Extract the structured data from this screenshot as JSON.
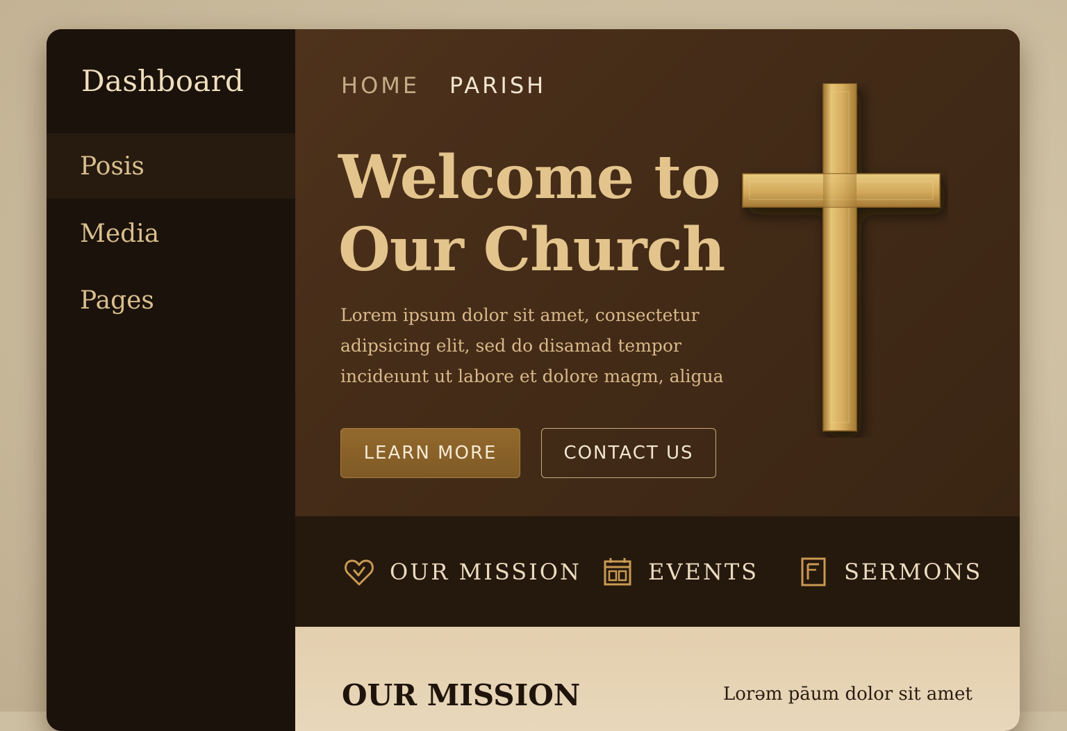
{
  "sidebar": {
    "title": "Dashboard",
    "items": [
      {
        "label": "Posis"
      },
      {
        "label": "Media"
      },
      {
        "label": "Pages"
      }
    ]
  },
  "nav": {
    "items": [
      {
        "label": "HOME"
      },
      {
        "label": "PARISH"
      }
    ]
  },
  "hero": {
    "title_lines": [
      "Welcome to",
      "Our Church"
    ],
    "text_lines": [
      "Lorem ipsum dolor sit amet, consectetur",
      "adipsicing elit, sed do disamad tempor",
      "incideıunt ut labore et dolore magm, aligua"
    ],
    "learn_more_label": "LEARN MORE",
    "contact_label": "CONTACT US",
    "image_icon": "golden-cross"
  },
  "subnav": {
    "items": [
      {
        "label": "OUR MISSION",
        "icon": "heart-icon"
      },
      {
        "label": "EVENTS",
        "icon": "calendar-icon"
      },
      {
        "label": "SERMONS",
        "icon": "document-icon"
      }
    ]
  },
  "content": {
    "title": "OUR MISSION",
    "text": "Lorəm pāum dolor sit amet"
  },
  "colors": {
    "accent_gold": "#e3c48c",
    "button_gold": "#8a6229",
    "dark_brown": "#1b120b",
    "hero_brown": "#4e321c",
    "cream": "#e3cfad"
  }
}
